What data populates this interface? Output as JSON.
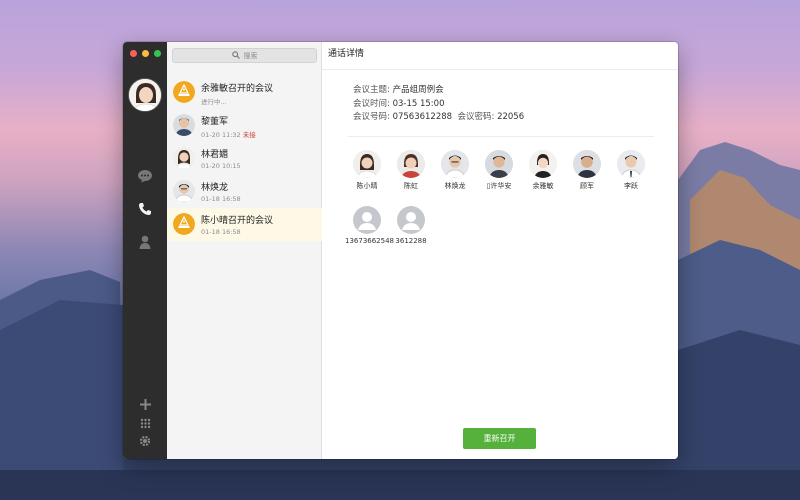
{
  "search": {
    "placeholder": "搜索"
  },
  "header": {
    "title": "通话详情"
  },
  "calls": [
    {
      "name": "余雅敏召开的会议",
      "status": "进行中...",
      "kind": "conference"
    },
    {
      "name": "黎董军",
      "time": "01-20 11:32",
      "status": "未接",
      "kind": "person"
    },
    {
      "name": "林君媚",
      "time": "01-20 10:15",
      "kind": "person"
    },
    {
      "name": "林焕龙",
      "time": "01-18 16:58",
      "kind": "person"
    },
    {
      "name": "陈小晴召开的会议",
      "time": "01-18 16:58",
      "kind": "conference"
    }
  ],
  "meeting": {
    "topic_label": "会议主题:",
    "topic": "产品组周例会",
    "time_label": "会议时间:",
    "time": "03-15 15:00",
    "number_label": "会议号码:",
    "number": "07563612288",
    "password_label": "会议密码:",
    "password": "22056"
  },
  "participants": [
    {
      "name": "陈小晴"
    },
    {
      "name": "陈虹"
    },
    {
      "name": "林焕龙"
    },
    {
      "name": "许华安"
    },
    {
      "name": "余雅敏"
    },
    {
      "name": "顾军"
    },
    {
      "name": "李跃"
    },
    {
      "name": "13673662548"
    },
    {
      "name": "3612288"
    }
  ],
  "actions": {
    "reopen_label": "重新召开"
  },
  "rail_icons": [
    "chat-icon",
    "phone-icon",
    "contacts-icon",
    "add-icon",
    "dialpad-icon",
    "settings-icon"
  ],
  "colors": {
    "accent_green": "#55b13c",
    "missed_red": "#d03a2f",
    "selected_bg": "#fdf9e6",
    "conference_orange": "#f0a91e"
  }
}
